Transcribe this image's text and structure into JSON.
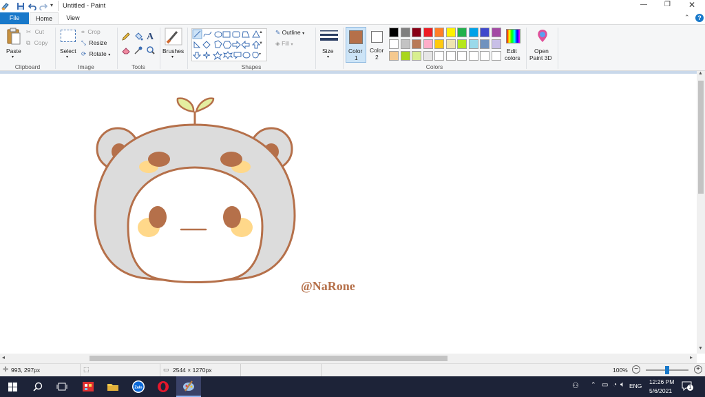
{
  "window": {
    "title": "Untitled - Paint",
    "minimize_glyph": "—",
    "restore_glyph": "❐",
    "close_glyph": "✕",
    "help_glyph": "?",
    "collapse_glyph": "⌃"
  },
  "tabs": [
    {
      "label": "File"
    },
    {
      "label": "Home"
    },
    {
      "label": "View"
    }
  ],
  "ribbon": {
    "clipboard": {
      "paste": "Paste",
      "cut": "Cut",
      "copy": "Copy",
      "group": "Clipboard"
    },
    "image": {
      "select": "Select",
      "crop": "Crop",
      "resize": "Resize",
      "rotate": "Rotate",
      "group": "Image"
    },
    "tools": {
      "group": "Tools"
    },
    "brushes": {
      "label": "Brushes"
    },
    "shapes": {
      "outline": "Outline",
      "fill": "Fill",
      "group": "Shapes"
    },
    "size": {
      "label": "Size"
    },
    "colors": {
      "color1_label_1": "Color",
      "color1_label_2": "1",
      "color2_label_1": "Color",
      "color2_label_2": "2",
      "color1": "#b5704a",
      "color2": "#ffffff",
      "edit_colors_1": "Edit",
      "edit_colors_2": "colors",
      "group": "Colors",
      "palette_row1": [
        "#000000",
        "#7f7f7f",
        "#880015",
        "#ed1c24",
        "#ff7f27",
        "#fff200",
        "#22b14c",
        "#00a2e8",
        "#3f48cc",
        "#a349a4"
      ],
      "palette_row2": [
        "#ffffff",
        "#c3c3c3",
        "#b97a57",
        "#ffaec9",
        "#ffc90e",
        "#efe4b0",
        "#b5e61d",
        "#99d9ea",
        "#7092be",
        "#c8bfe7"
      ],
      "palette_row3": [
        "#f5c98e",
        "#a9d61c",
        "#d8ef8f",
        "#e6e6e6",
        "#ffffff",
        "#ffffff",
        "#ffffff",
        "#ffffff",
        "#ffffff",
        "#ffffff"
      ]
    },
    "paint3d": {
      "label_1": "Open",
      "label_2": "Paint 3D"
    }
  },
  "canvas": {
    "watermark": "@NaRone",
    "outline_color": "#b5704a",
    "hood_color": "#dcdcdc",
    "blush_color": "#ffd88a",
    "sprout_color": "#e4eea0"
  },
  "status": {
    "cursor_pos": "993, 297px",
    "image_size": "2544 × 1270px",
    "zoom": "100%",
    "zoom_level": 0.5
  },
  "taskbar": {
    "time": "12:26 PM",
    "date": "5/6/2021",
    "lang": "ENG",
    "notification_count": "1",
    "zalo_label": "Zalo"
  }
}
